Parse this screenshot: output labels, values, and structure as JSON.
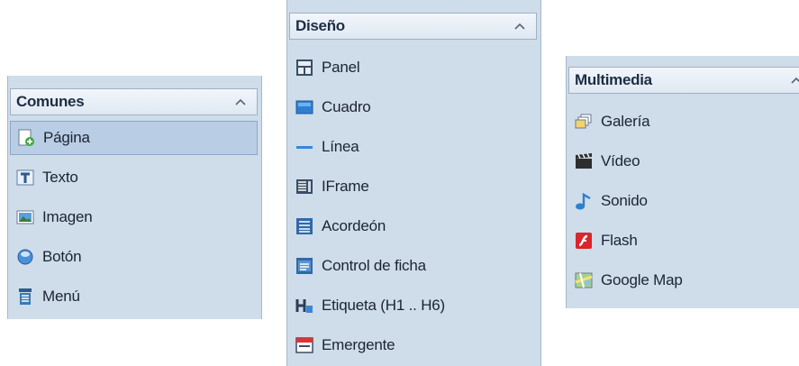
{
  "panels": {
    "comunes": {
      "title": "Comunes",
      "items": [
        "Página",
        "Texto",
        "Imagen",
        "Botón",
        "Menú"
      ],
      "selected_index": 0
    },
    "diseno": {
      "title": "Diseño",
      "items": [
        "Panel",
        "Cuadro",
        "Línea",
        "IFrame",
        "Acordeón",
        "Control de ficha",
        "Etiqueta (H1 .. H6)",
        "Emergente"
      ]
    },
    "multimedia": {
      "title": "Multimedia",
      "items": [
        "Galería",
        "Vídeo",
        "Sonido",
        "Flash",
        "Google Map"
      ]
    }
  },
  "icons": {
    "comunes": [
      "page-add-icon",
      "text-icon",
      "image-icon",
      "button-icon",
      "menu-icon"
    ],
    "diseno": [
      "panel-icon",
      "box-icon",
      "line-icon",
      "iframe-icon",
      "accordion-icon",
      "tab-control-icon",
      "heading-icon",
      "popup-icon"
    ],
    "multimedia": [
      "gallery-icon",
      "video-icon",
      "sound-icon",
      "flash-icon",
      "google-map-icon"
    ]
  },
  "colors": {
    "panel_bg": "#cfdcea",
    "selected_bg": "#b9cde4",
    "header_text": "#1d2d44"
  }
}
